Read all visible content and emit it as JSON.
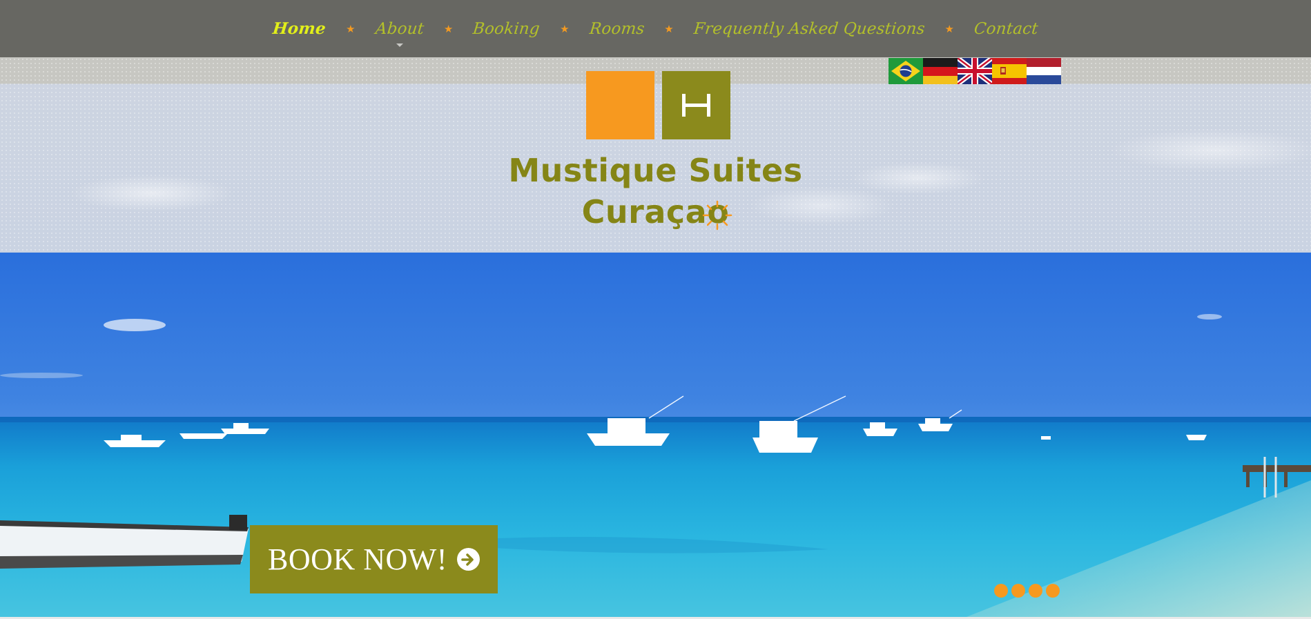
{
  "nav": {
    "items": [
      {
        "label": "Home",
        "active": true
      },
      {
        "label": "About",
        "has_submenu": true
      },
      {
        "label": "Booking"
      },
      {
        "label": "Rooms"
      },
      {
        "label": "Frequently Asked Questions"
      },
      {
        "label": "Contact"
      }
    ],
    "separator": "★"
  },
  "logo": {
    "line1": "Mustique Suites",
    "line2": "Curaçao",
    "icons": [
      "orange-square",
      "hotel-bed-icon",
      "sun-icon"
    ]
  },
  "flags": [
    "brazil-flag",
    "germany-flag",
    "uk-flag",
    "spain-flag",
    "netherlands-flag"
  ],
  "hero": {
    "cta_label": "BOOK NOW!",
    "cta_icon": "arrow-circle-right-icon",
    "slides_count": 4
  },
  "colors": {
    "nav_bg": "#676762",
    "nav_text": "#b3c02a",
    "nav_active": "#e2ef1a",
    "accent_orange": "#f7991f",
    "brand_olive": "#8b8a1c"
  }
}
